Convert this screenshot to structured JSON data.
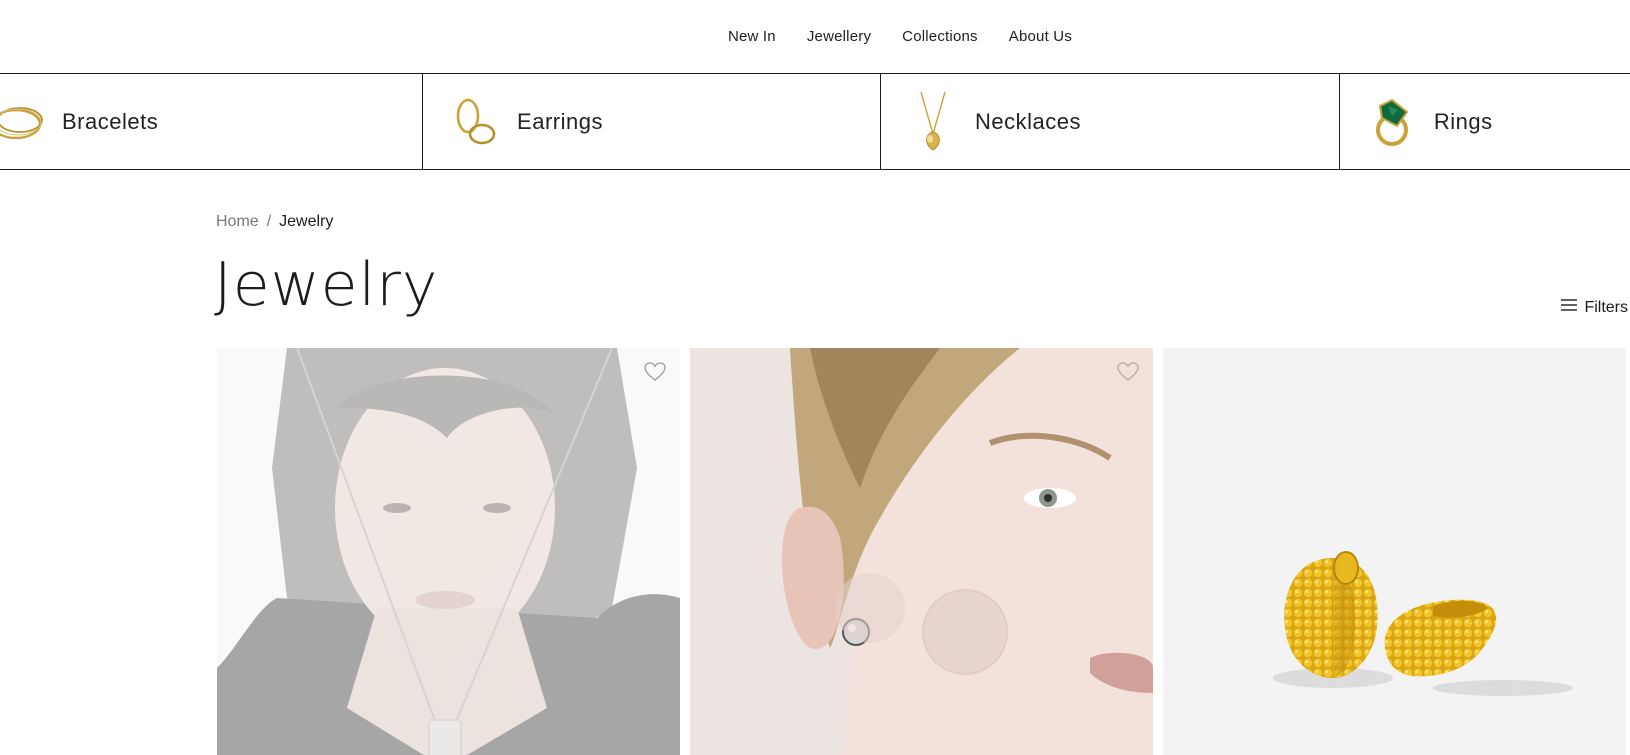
{
  "nav": {
    "items": [
      {
        "label": "New In"
      },
      {
        "label": "Jewellery"
      },
      {
        "label": "Collections"
      },
      {
        "label": "About Us"
      }
    ]
  },
  "categories": [
    {
      "label": "Bracelets",
      "icon": "bracelet-icon"
    },
    {
      "label": "Earrings",
      "icon": "earrings-icon"
    },
    {
      "label": "Necklaces",
      "icon": "necklace-icon"
    },
    {
      "label": "Rings",
      "icon": "ring-icon"
    }
  ],
  "breadcrumb": {
    "home": "Home",
    "separator": "/",
    "current": "Jewelry"
  },
  "page": {
    "title": "Jewelry",
    "filters_label": "Filters"
  },
  "products": [
    {
      "image": "model-necklace-photo",
      "wishlist_icon": "heart-icon"
    },
    {
      "image": "model-earring-photo",
      "wishlist_icon": "heart-icon"
    },
    {
      "image": "gold-hoop-earrings-photo"
    }
  ],
  "colors": {
    "gold": "#c9a23a",
    "line": "#1c1c1c",
    "emerald": "#0f6b3e"
  }
}
